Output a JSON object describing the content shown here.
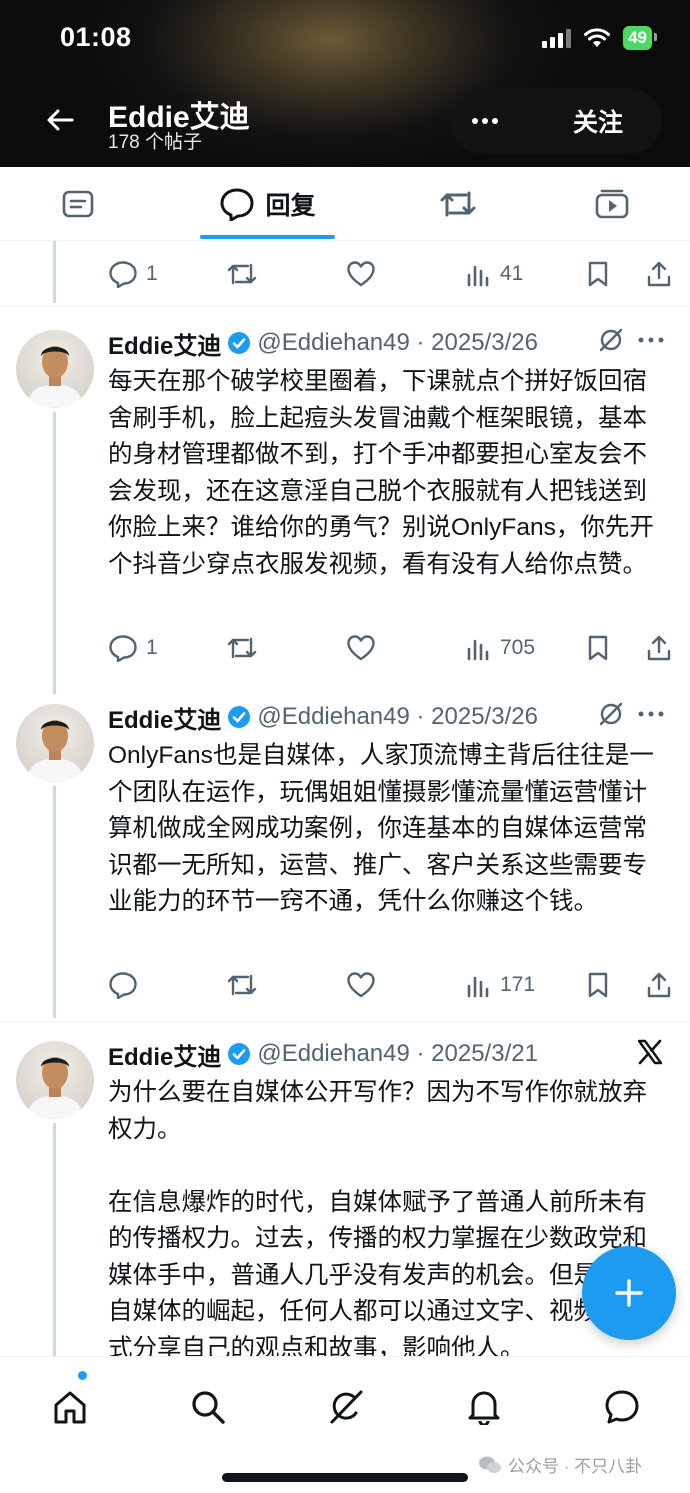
{
  "status_bar": {
    "time": "01:08",
    "battery": "49"
  },
  "header": {
    "name": "Eddie艾迪",
    "post_count": "178 个帖子",
    "follow_label": "关注"
  },
  "tabs": [
    {
      "label": "",
      "icon": "article-icon"
    },
    {
      "label": "回复",
      "icon": "reply-bubble-icon",
      "selected": true
    },
    {
      "label": "",
      "icon": "repost-icon"
    },
    {
      "label": "",
      "icon": "media-icon"
    }
  ],
  "top_actions": {
    "replies": "1",
    "views": "41"
  },
  "tweets": [
    {
      "author": "Eddie艾迪",
      "handle_date": "@Eddiehan49 · 2025/3/26",
      "text": "每天在那个破学校里圈着，下课就点个拼好饭回宿舍刷手机，脸上起痘头发冒油戴个框架眼镜，基本的身材管理都做不到，打个手冲都要担心室友会不会发现，还在这意淫自己脱个衣服就有人把钱送到你脸上来？谁给你的勇气？别说OnlyFans，你先开个抖音少穿点衣服发视频，看有没有人给你点赞。",
      "replies": "1",
      "views": "705"
    },
    {
      "author": "Eddie艾迪",
      "handle_date": "@Eddiehan49 · 2025/3/26",
      "text": "OnlyFans也是自媒体，人家顶流博主背后往往是一个团队在运作，玩偶姐姐懂摄影懂流量懂运营懂计算机做成全网成功案例，你连基本的自媒体运营常识都一无所知，运营、推广、客户关系这些需要专业能力的环节一窍不通，凭什么你赚这个钱。",
      "replies": "",
      "views": "171"
    },
    {
      "author": "Eddie艾迪",
      "handle_date": "@Eddiehan49 · 2025/3/21",
      "text": "为什么要在自媒体公开写作？因为不写作你就放弃权力。\n\n在信息爆炸的时代，自媒体赋予了普通人前所未有的传播权力。过去，传播的权力掌握在少数政党和媒体手中，普通人几乎没有发声的机会。但是随着自媒体的崛起，任何人都可以通过文字、视频等形式分享自己的观点和故事，影响他人。"
    }
  ],
  "bottom_nav": [
    {
      "icon": "home-icon"
    },
    {
      "icon": "search-icon"
    },
    {
      "icon": "grok-icon"
    },
    {
      "icon": "bell-icon"
    },
    {
      "icon": "message-icon"
    }
  ],
  "watermark": "公众号 · 不只八卦",
  "colors": {
    "accent": "#1d9bf0",
    "text": "#0f1419",
    "muted": "#536471",
    "header_bg": "#0b0b0b"
  }
}
